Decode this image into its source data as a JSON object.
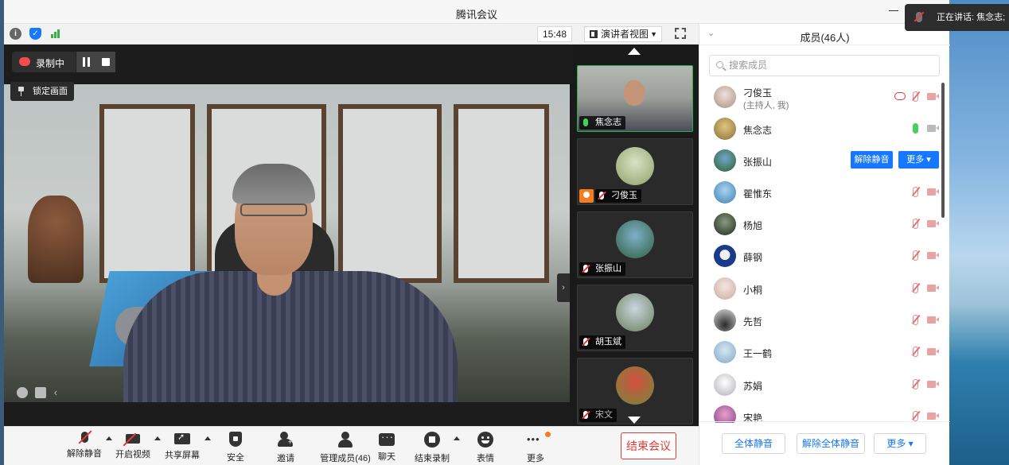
{
  "app": {
    "title": "腾讯会议"
  },
  "top_toolbar": {
    "clock": "15:48",
    "view_mode": "演讲者视图",
    "icons": [
      "info-icon",
      "security-shield-icon",
      "signal-icon",
      "fullscreen-icon"
    ]
  },
  "recording": {
    "label": "录制中"
  },
  "lock_view": {
    "label": "锁定画面"
  },
  "gallery": {
    "tiles": [
      {
        "name": "焦念志",
        "mic": "live",
        "avatar_color": "#8a7d6a"
      },
      {
        "name": "刁俊玉",
        "mic": "muted",
        "host": true,
        "avatar_color": "#b9c6a4"
      },
      {
        "name": "张振山",
        "mic": "muted",
        "avatar_color": "#3f6f8f"
      },
      {
        "name": "胡玉斌",
        "mic": "muted",
        "avatar_color": "#8a9a7a"
      },
      {
        "name": "宋文",
        "mic": "muted",
        "avatar_color": "#b9a050"
      }
    ]
  },
  "bottom_bar": {
    "buttons": [
      {
        "label": "解除静音",
        "icon": "mic-muted-icon"
      },
      {
        "label": "开启视频",
        "icon": "camera-off-icon"
      },
      {
        "label": "共享屏幕",
        "icon": "share-screen-icon"
      },
      {
        "label": "安全",
        "icon": "shield-icon"
      },
      {
        "label": "邀请",
        "icon": "invite-user-icon"
      },
      {
        "label": "管理成员(46)",
        "icon": "members-icon"
      },
      {
        "label": "聊天",
        "icon": "chat-icon"
      },
      {
        "label": "结束录制",
        "icon": "stop-record-icon"
      },
      {
        "label": "表情",
        "icon": "emoji-icon"
      },
      {
        "label": "更多",
        "icon": "more-icon"
      }
    ],
    "end_meeting": "结束会议"
  },
  "members_panel": {
    "title": "成员(46人)",
    "search_placeholder": "搜索成员",
    "members": [
      {
        "name": "刁俊玉",
        "sub": "(主持人, 我)",
        "mic": "muted",
        "recording": true,
        "avatar_color": "#d9c6c0"
      },
      {
        "name": "焦念志",
        "mic": "live",
        "camera": "off",
        "avatar_color": "#c9a95f"
      },
      {
        "name": "张振山",
        "actions": [
          "解除静音",
          "更多 ▾"
        ],
        "avatar_color": "#2f5f7f"
      },
      {
        "name": "瞿惟东",
        "mic": "muted",
        "avatar_color": "#6fa8d8"
      },
      {
        "name": "杨旭",
        "mic": "muted",
        "avatar_color": "#3b4a3a"
      },
      {
        "name": "薛钢",
        "mic": "muted",
        "avatar_color": "#1f3f7f"
      },
      {
        "name": "小桐",
        "mic": "muted",
        "avatar_color": "#e8d6cf"
      },
      {
        "name": "先哲",
        "mic": "muted",
        "avatar_color": "#4a4a4a"
      },
      {
        "name": "王一鹤",
        "mic": "muted",
        "avatar_color": "#a9c8de"
      },
      {
        "name": "苏娟",
        "mic": "muted",
        "avatar_color": "#dedede"
      },
      {
        "name": "宋艳",
        "mic": "muted",
        "avatar_color": "#c86fa5"
      }
    ],
    "footer": {
      "mute_all": "全体静音",
      "unmute_all": "解除全体静音",
      "more": "更多 ▾"
    }
  },
  "speaking_banner": {
    "text": "正在讲话: 焦念志;"
  },
  "colors": {
    "accent": "#1677ff",
    "danger": "#e53935",
    "live": "#46cf5e",
    "host_badge": "#f57c1f"
  }
}
